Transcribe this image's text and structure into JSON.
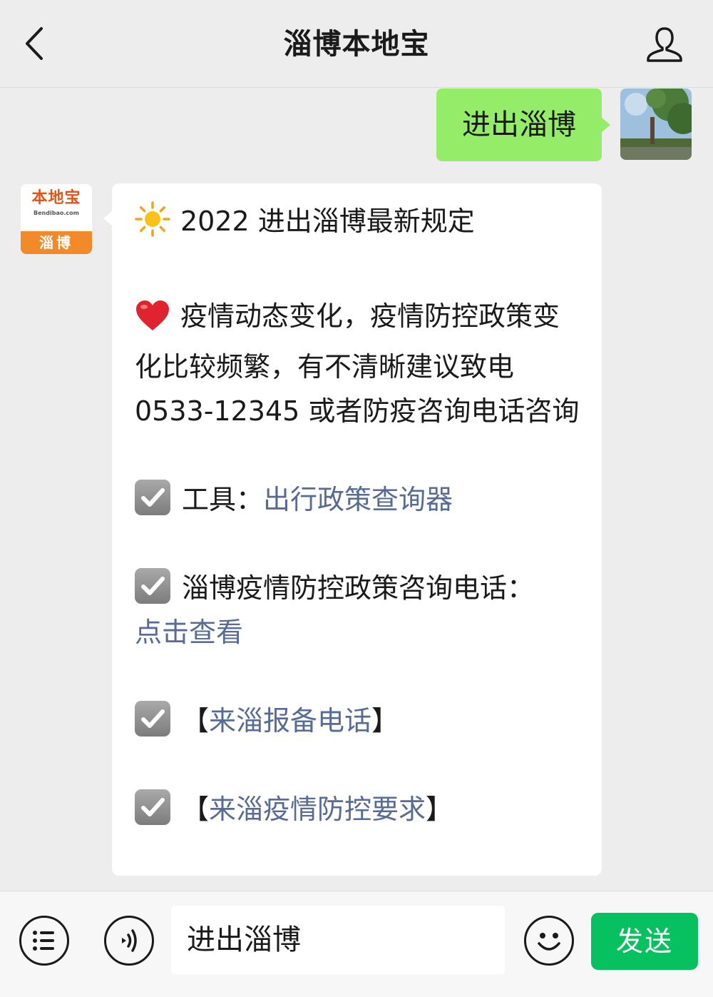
{
  "header": {
    "title": "淄博本地宝",
    "back_icon": "chevron-left-icon",
    "profile_icon": "user-icon"
  },
  "messages": {
    "outgoing": {
      "text": "进出淄博",
      "bubble_color": "#95ec69"
    },
    "bot_avatar": {
      "brand": "本地宝",
      "url": "Bendibao.com",
      "city": "淄博",
      "accent": "#f28a2a"
    },
    "incoming": {
      "title_emoji": "sun-emoji",
      "title": "2022 进出淄博最新规定",
      "notice_emoji": "red-heart-emoji",
      "notice": "疫情动态变化，疫情防控政策变化比较频繁，有不清晰建议致电 0533-12345 或者防疫咨询电话咨询",
      "items": [
        {
          "icon": "checkbox-icon",
          "prefix": "工具：",
          "link": "出行政策查询器",
          "suffix": ""
        },
        {
          "icon": "checkbox-icon",
          "prefix": "淄博疫情防控政策咨询电话：",
          "link": "点击查看",
          "suffix": ""
        },
        {
          "icon": "checkbox-icon",
          "prefix": "【",
          "link": "来淄报备电话",
          "suffix": "】"
        },
        {
          "icon": "checkbox-icon",
          "prefix": "【",
          "link": "来淄疫情防控要求",
          "suffix": "】"
        }
      ],
      "link_color": "#576b95"
    }
  },
  "input_bar": {
    "menu_icon": "menu-list-icon",
    "voice_icon": "voice-icon",
    "input_value": "进出淄博",
    "emoji_icon": "smiley-icon",
    "send_label": "发送",
    "send_color": "#07c160"
  }
}
